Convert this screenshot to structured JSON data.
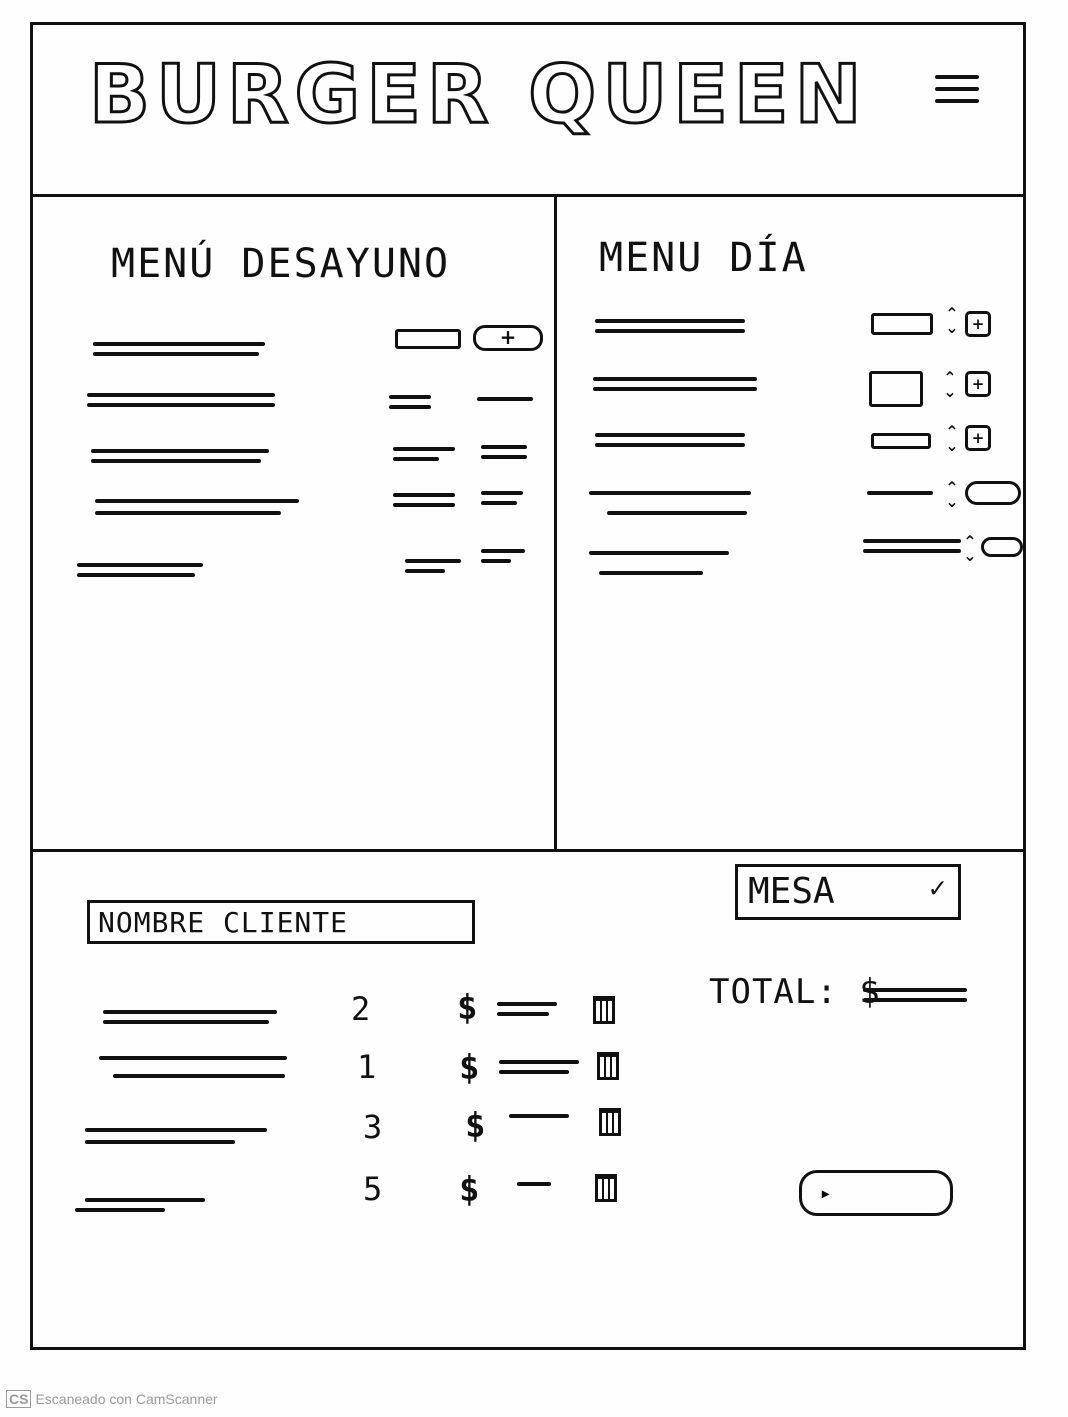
{
  "header": {
    "brand": "BURGER QUEEN",
    "menu_icon": "hamburger-menu-icon"
  },
  "breakfast_menu": {
    "title": "MENÚ DESAYUNO"
  },
  "day_menu": {
    "title": "MENU DÍA"
  },
  "order": {
    "client_name_placeholder": "NOMBRE CLIENTE",
    "table_select": "MESA",
    "total_label": "TOTAL: $",
    "items": [
      {
        "qty": "2",
        "currency": "$"
      },
      {
        "qty": "1",
        "currency": "$"
      },
      {
        "qty": "3",
        "currency": "$"
      },
      {
        "qty": "5",
        "currency": "$"
      }
    ],
    "send_button": "▸"
  },
  "footer": {
    "badge": "CS",
    "text": "Escaneado con CamScanner"
  }
}
